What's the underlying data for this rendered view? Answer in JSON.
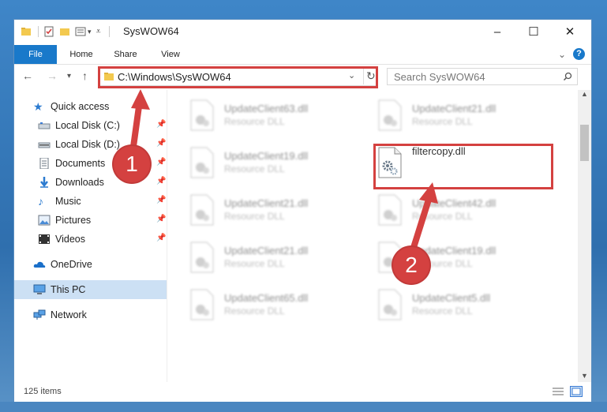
{
  "window": {
    "title": "SysWOW64",
    "controls": {
      "minimize": "–",
      "maximize": "☐",
      "close": "✕"
    }
  },
  "ribbon": {
    "tabs": [
      "File",
      "Home",
      "Share",
      "View"
    ],
    "expand_glyph": "⌄",
    "help_glyph": "?"
  },
  "address": {
    "path": "C:\\Windows\\SysWOW64",
    "search_placeholder": "Search SysWOW64"
  },
  "nav": {
    "quick_access": "Quick access",
    "items": [
      {
        "label": "Local Disk (C:)",
        "icon": "drive-icon",
        "pinned": true
      },
      {
        "label": "Local Disk (D:)",
        "icon": "drive-icon",
        "pinned": true
      },
      {
        "label": "Documents",
        "icon": "documents-icon",
        "pinned": true
      },
      {
        "label": "Downloads",
        "icon": "downloads-icon",
        "pinned": true
      },
      {
        "label": "Music",
        "icon": "music-icon",
        "pinned": true
      },
      {
        "label": "Pictures",
        "icon": "pictures-icon",
        "pinned": true
      },
      {
        "label": "Videos",
        "icon": "videos-icon",
        "pinned": true
      }
    ],
    "onedrive": "OneDrive",
    "this_pc": "This PC",
    "network": "Network"
  },
  "files": [
    {
      "name": "UpdateClient63.dll",
      "type": "Resource DLL",
      "blurred": true
    },
    {
      "name": "UpdateClient21.dll",
      "type": "Resource DLL",
      "blurred": true
    },
    {
      "name": "UpdateClient19.dll",
      "type": "Resource DLL",
      "blurred": true
    },
    {
      "name": "filtercopy.dll",
      "type": "",
      "blurred": false
    },
    {
      "name": "UpdateClient21.dll",
      "type": "Resource DLL",
      "blurred": true
    },
    {
      "name": "UpdateClient42.dll",
      "type": "Resource DLL",
      "blurred": true
    },
    {
      "name": "UpdateClient21.dll",
      "type": "Resource DLL",
      "blurred": true
    },
    {
      "name": "UpdateClient19.dll",
      "type": "Resource DLL",
      "blurred": true
    },
    {
      "name": "UpdateClient65.dll",
      "type": "Resource DLL",
      "blurred": true
    },
    {
      "name": "UpdateClient5.dll",
      "type": "Resource DLL",
      "blurred": true
    }
  ],
  "status": {
    "item_count": "125 items"
  },
  "annotations": {
    "callout_1": "1",
    "callout_2": "2",
    "color": "#d44140"
  },
  "colors": {
    "accent": "#1979ca",
    "selected": "#cce0f4"
  }
}
